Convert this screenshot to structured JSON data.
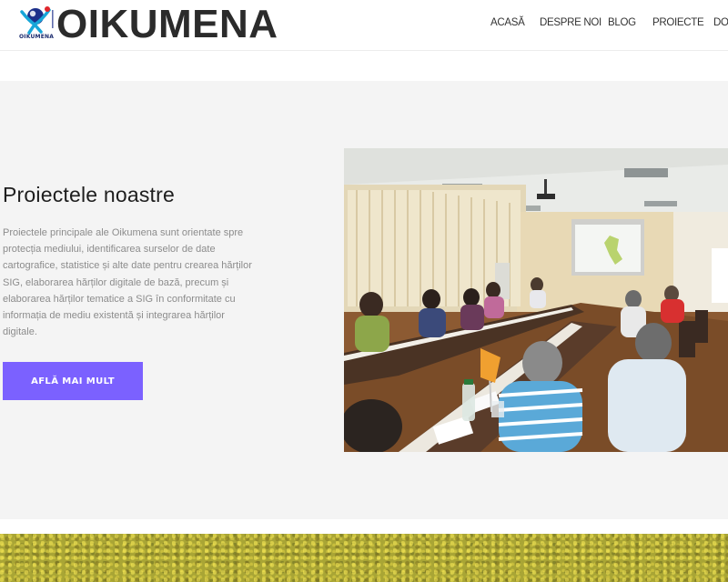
{
  "header": {
    "logo_text": "OIKUMENA",
    "logo_small_text": "OIKUMENA",
    "nav": [
      {
        "label": "ACASĂ"
      },
      {
        "label": "DESPRE NOI"
      },
      {
        "label": "BLOG"
      },
      {
        "label": "PROIECTE"
      },
      {
        "label": "DON"
      }
    ]
  },
  "hero": {
    "title": "Proiectele noastre",
    "description": "Proiectele principale ale Oikumena sunt orientate spre protecția mediului, identificarea surselor de date cartografice, statistice și alte date pentru crearea hărților SIG, elaborarea hărților digitale de bază, precum și elaborarea hărților tematice a SIG în conformitate cu informația de mediu existentă și integrarea hărților digitale.",
    "cta_label": "AFLĂ MAI MULT",
    "photo_icon": "conference-meeting-photo"
  },
  "colors": {
    "accent": "#7b61ff",
    "hero_background": "#f4f4f4",
    "title_text": "#1e1e1e",
    "body_text": "#8c8c8c",
    "meadow": "#a9a535"
  }
}
